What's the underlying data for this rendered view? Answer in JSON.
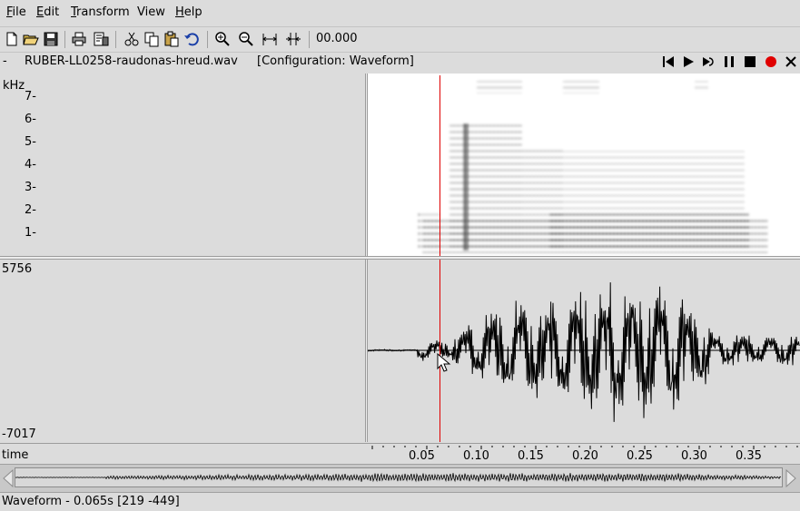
{
  "menu": {
    "file": {
      "mnemonic": "F",
      "rest": "ile"
    },
    "edit": {
      "mnemonic": "E",
      "rest": "dit"
    },
    "transform": {
      "mnemonic": "T",
      "rest": "ransform"
    },
    "view": {
      "label": "View"
    },
    "help": {
      "mnemonic": "H",
      "rest": "elp"
    }
  },
  "toolbar": {
    "icons": [
      "new-file-icon",
      "open-folder-icon",
      "save-icon",
      "print-icon",
      "print-setup-icon",
      "cut-icon",
      "copy-icon",
      "paste-icon",
      "undo-icon",
      "zoom-in-icon",
      "zoom-out-icon",
      "zoom-fit-icon",
      "zoom-selection-icon"
    ],
    "time_readout": "00.000"
  },
  "infobar": {
    "dash": "-",
    "filename": "RUBER-LL0258-raudonas-hreud.wav",
    "configuration": "[Configuration: Waveform]"
  },
  "playback": {
    "icons": [
      "skip-start-icon",
      "play-icon",
      "loop-play-icon",
      "pause-icon",
      "stop-icon",
      "record-icon",
      "close-icon"
    ],
    "record_color": "#e00000"
  },
  "spectrogram": {
    "unit": "kHz",
    "ticks": [
      "7-",
      "6-",
      "5-",
      "4-",
      "3-",
      "2-",
      "1-"
    ]
  },
  "waveform": {
    "max": "5756",
    "min": "-7017"
  },
  "axis": {
    "label": "time",
    "ticks": [
      "0.05",
      "0.10",
      "0.15",
      "0.20",
      "0.25",
      "0.30",
      "0.35"
    ]
  },
  "cursor": {
    "time": 0.065,
    "color": "#e00000"
  },
  "status": {
    "text": "Waveform - 0.065s [219 -449]"
  }
}
